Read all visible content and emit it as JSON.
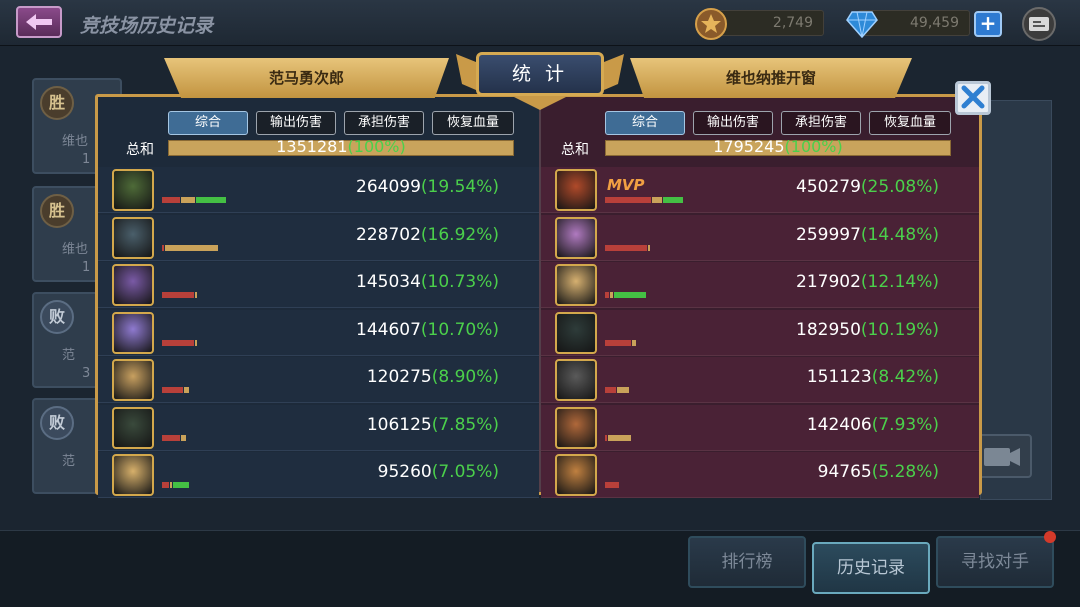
{
  "header": {
    "title": "竞技场历史记录",
    "gold": "2,749",
    "gems": "49,459",
    "plus_label": "+"
  },
  "colors": {
    "accent_gold": "#c99a48",
    "left_team_bg": "#1d2a3a",
    "right_team_bg": "#3a1e2e",
    "percent_green": "#4bd04b",
    "mvp_orange": "#f0a043",
    "dmg_red": "#b8403a",
    "tank_tan": "#c9a25a",
    "heal_green": "#44c044"
  },
  "background_history": [
    {
      "result": "胜",
      "name": "维也",
      "score": "1"
    },
    {
      "result": "胜",
      "name": "维也",
      "score": "1"
    },
    {
      "result": "败",
      "name": "范",
      "score": "3"
    },
    {
      "result": "败",
      "name": "范",
      "score": ""
    }
  ],
  "bottom_nav": {
    "ranking": "排行榜",
    "history": "历史记录",
    "find_opponent": "寻找对手"
  },
  "stats": {
    "title": "统 计",
    "close_icon": "close-icon",
    "left_team": {
      "player": "范马勇次郎",
      "filters": [
        "综合",
        "输出伤害",
        "承担伤害",
        "恢复血量"
      ],
      "total_label": "总和",
      "total_value": "1351281",
      "total_pct": "(100%)",
      "heroes": [
        {
          "value": "264099",
          "pct": "(19.54%)",
          "dmg": 0.1,
          "tank": 0.08,
          "heal": 0.17,
          "color": "#4e6b38"
        },
        {
          "value": "228702",
          "pct": "(16.92%)",
          "dmg": 0.01,
          "tank": 0.3,
          "heal": 0,
          "color": "#4a5f6b"
        },
        {
          "value": "145034",
          "pct": "(10.73%)",
          "dmg": 0.18,
          "tank": 0.01,
          "heal": 0,
          "color": "#7a5aa6"
        },
        {
          "value": "144607",
          "pct": "(10.70%)",
          "dmg": 0.18,
          "tank": 0.01,
          "heal": 0,
          "color": "#8f7ad0"
        },
        {
          "value": "120275",
          "pct": "(8.90%)",
          "dmg": 0.12,
          "tank": 0.03,
          "heal": 0,
          "color": "#c8a060"
        },
        {
          "value": "106125",
          "pct": "(7.85%)",
          "dmg": 0.1,
          "tank": 0.03,
          "heal": 0,
          "color": "#3a4a3c"
        },
        {
          "value": "95260",
          "pct": "(7.05%)",
          "dmg": 0.04,
          "tank": 0.01,
          "heal": 0.09,
          "color": "#d7b06b"
        }
      ]
    },
    "right_team": {
      "player": "维也纳推开窗",
      "filters": [
        "综合",
        "输出伤害",
        "承担伤害",
        "恢复血量"
      ],
      "total_label": "总和",
      "total_value": "1795245",
      "total_pct": "(100%)",
      "mvp_label": "MVP",
      "heroes": [
        {
          "value": "450279",
          "pct": "(25.08%)",
          "dmg": 0.26,
          "tank": 0.06,
          "heal": 0.11,
          "color": "#b04a2a",
          "mvp": true
        },
        {
          "value": "259997",
          "pct": "(14.48%)",
          "dmg": 0.24,
          "tank": 0.01,
          "heal": 0,
          "color": "#b07ac0"
        },
        {
          "value": "217902",
          "pct": "(12.14%)",
          "dmg": 0.02,
          "tank": 0.02,
          "heal": 0.18,
          "color": "#d6b070"
        },
        {
          "value": "182950",
          "pct": "(10.19%)",
          "dmg": 0.15,
          "tank": 0.02,
          "heal": 0,
          "color": "#2e3c3a"
        },
        {
          "value": "151123",
          "pct": "(8.42%)",
          "dmg": 0.06,
          "tank": 0.07,
          "heal": 0,
          "color": "#5a5a5a"
        },
        {
          "value": "142406",
          "pct": "(7.93%)",
          "dmg": 0.01,
          "tank": 0.13,
          "heal": 0,
          "color": "#b0683a"
        },
        {
          "value": "94765",
          "pct": "(5.28%)",
          "dmg": 0.08,
          "tank": 0,
          "heal": 0,
          "color": "#c08040"
        }
      ]
    }
  }
}
